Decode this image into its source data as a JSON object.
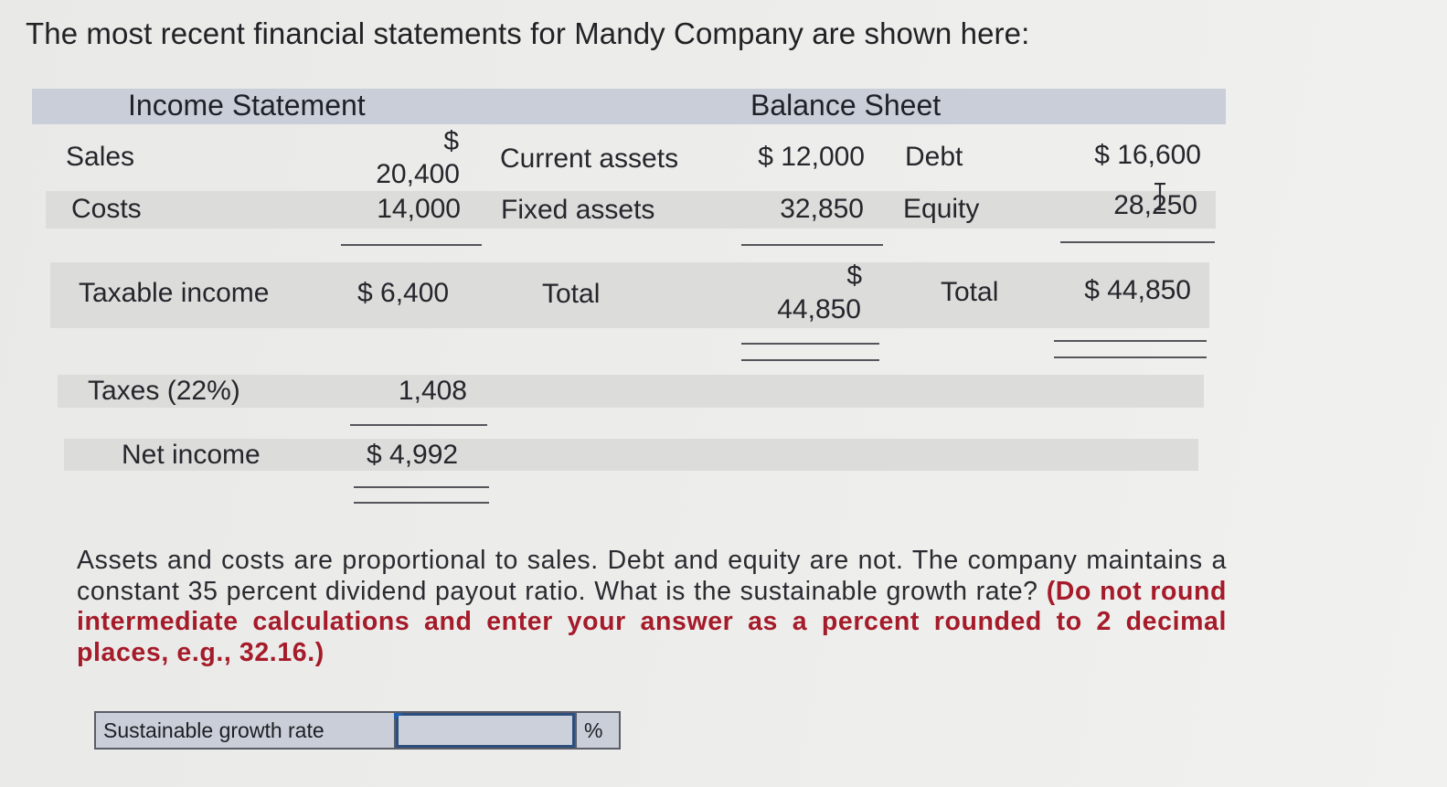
{
  "intro": "The most recent financial statements for Mandy Company are shown here:",
  "income_statement": {
    "title": "Income Statement",
    "rows": [
      {
        "label": "Sales",
        "currency": "$",
        "value": "20,400"
      },
      {
        "label": "Costs",
        "value": "14,000"
      },
      {
        "label": "Taxable income",
        "value": "$ 6,400"
      },
      {
        "label": "Taxes (22%)",
        "value": "1,408"
      },
      {
        "label": "Net income",
        "value": "$ 4,992"
      }
    ]
  },
  "balance_sheet": {
    "title": "Balance Sheet",
    "assets": [
      {
        "label": "Current assets",
        "value": "$ 12,000"
      },
      {
        "label": "Fixed assets",
        "value": "32,850"
      }
    ],
    "assets_total": {
      "label": "Total",
      "currency": "$",
      "value": "44,850"
    },
    "liabilities": [
      {
        "label": "Debt",
        "value": "$ 16,600"
      },
      {
        "label": "Equity",
        "value": "28,250"
      }
    ],
    "liabilities_total": {
      "label": "Total",
      "value": "$ 44,850"
    }
  },
  "question": {
    "text": "Assets and costs are proportional to sales. Debt and equity are not. The company maintains a constant 35 percent dividend payout ratio. What is the sustainable growth rate? ",
    "instruction": "(Do not round intermediate calculations and enter your answer as a percent rounded to 2 decimal places, e.g., 32.16.)"
  },
  "answer": {
    "label": "Sustainable growth rate",
    "value": "",
    "unit": "%"
  },
  "colors": {
    "header_band": "#c9ced8",
    "row_band": "#dcdcdb",
    "instruction_red": "#a51b2a",
    "input_border": "#2e4f7e"
  }
}
